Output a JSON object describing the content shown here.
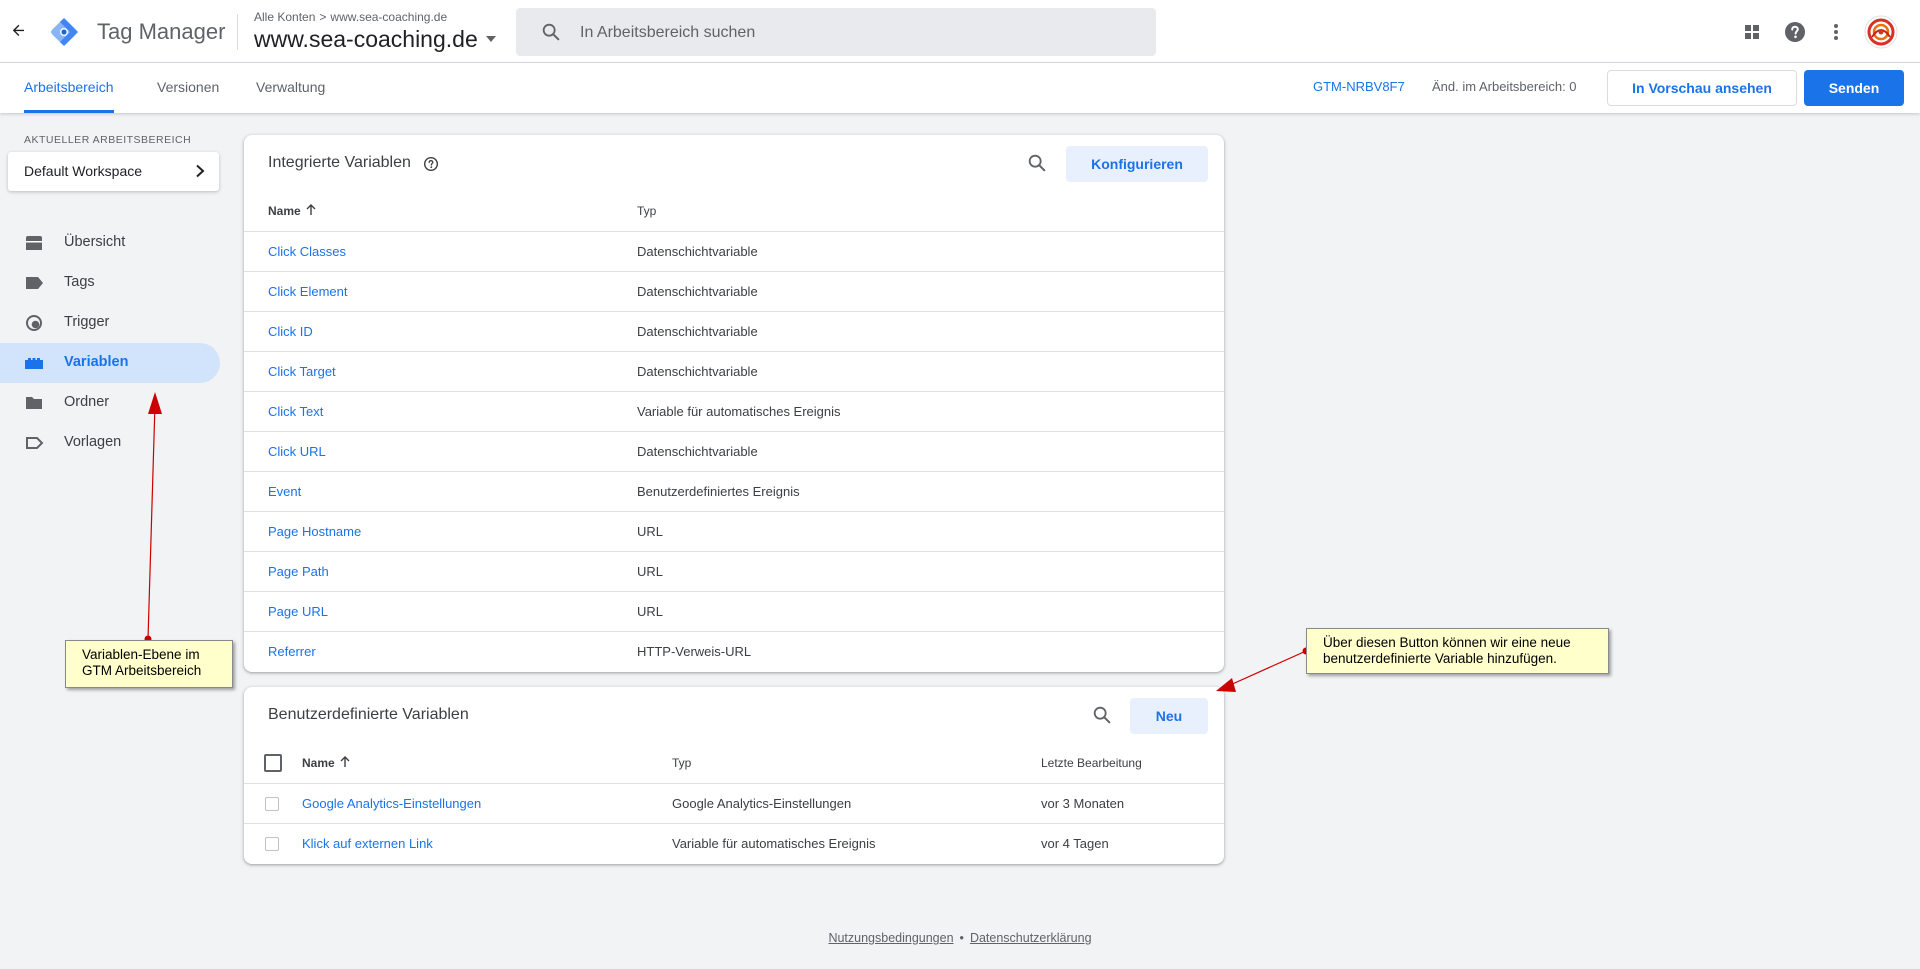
{
  "app": {
    "product_name": "Tag Manager",
    "breadcrumb_root": "Alle Konten",
    "breadcrumb_sep": ">",
    "breadcrumb_account": "www.sea-coaching.de",
    "container_name": "www.sea-coaching.de",
    "search_placeholder": "In Arbeitsbereich suchen"
  },
  "icons": {
    "back": "arrow-back-icon",
    "search": "search-icon",
    "apps": "apps-grid-icon",
    "help": "help-circle-icon",
    "more": "more-vert-icon"
  },
  "subnav": {
    "tabs": [
      {
        "label": "Arbeitsbereich",
        "active": true
      },
      {
        "label": "Versionen",
        "active": false
      },
      {
        "label": "Verwaltung",
        "active": false
      }
    ],
    "container_id": "GTM-NRBV8F7",
    "changes_label": "Änd. im Arbeitsbereich: 0",
    "preview_label": "In Vorschau ansehen",
    "submit_label": "Senden"
  },
  "sidebar": {
    "workspace_label": "AKTUELLER ARBEITSBEREICH",
    "workspace_name": "Default Workspace",
    "items": [
      {
        "label": "Übersicht",
        "icon": "overview-icon"
      },
      {
        "label": "Tags",
        "icon": "tag-icon"
      },
      {
        "label": "Trigger",
        "icon": "trigger-icon"
      },
      {
        "label": "Variablen",
        "icon": "variables-icon",
        "active": true
      },
      {
        "label": "Ordner",
        "icon": "folder-icon"
      },
      {
        "label": "Vorlagen",
        "icon": "template-icon"
      }
    ]
  },
  "builtin": {
    "title": "Integrierte Variablen",
    "configure_label": "Konfigurieren",
    "col_name": "Name",
    "col_type": "Typ",
    "rows": [
      {
        "name": "Click Classes",
        "type": "Datenschichtvariable"
      },
      {
        "name": "Click Element",
        "type": "Datenschichtvariable"
      },
      {
        "name": "Click ID",
        "type": "Datenschichtvariable"
      },
      {
        "name": "Click Target",
        "type": "Datenschichtvariable"
      },
      {
        "name": "Click Text",
        "type": "Variable für automatisches Ereignis"
      },
      {
        "name": "Click URL",
        "type": "Datenschichtvariable"
      },
      {
        "name": "Event",
        "type": "Benutzerdefiniertes Ereignis"
      },
      {
        "name": "Page Hostname",
        "type": "URL"
      },
      {
        "name": "Page Path",
        "type": "URL"
      },
      {
        "name": "Page URL",
        "type": "URL"
      },
      {
        "name": "Referrer",
        "type": "HTTP-Verweis-URL"
      }
    ]
  },
  "custom": {
    "title": "Benutzerdefinierte Variablen",
    "new_label": "Neu",
    "col_name": "Name",
    "col_type": "Typ",
    "col_edited": "Letzte Bearbeitung",
    "rows": [
      {
        "name": "Google Analytics-Einstellungen",
        "type": "Google Analytics-Einstellungen",
        "edited": "vor 3 Monaten"
      },
      {
        "name": "Klick auf externen Link",
        "type": "Variable für automatisches Ereignis",
        "edited": "vor 4 Tagen"
      }
    ]
  },
  "footer": {
    "terms": "Nutzungsbedingungen",
    "sep": "•",
    "privacy": "Datenschutzerklärung"
  },
  "annotations": {
    "left_note_line1": "Variablen-Ebene im",
    "left_note_line2": "GTM Arbeitsbereich",
    "right_note_line1": "Über diesen Button können wir eine neue",
    "right_note_line2": "benutzerdefinierte Variable hinzufügen."
  },
  "colors": {
    "accent": "#1a73e8",
    "active_nav_bg": "#d2e3fc",
    "annotation_bg": "#ffffcc",
    "annotation_arrow": "#cc0000"
  }
}
